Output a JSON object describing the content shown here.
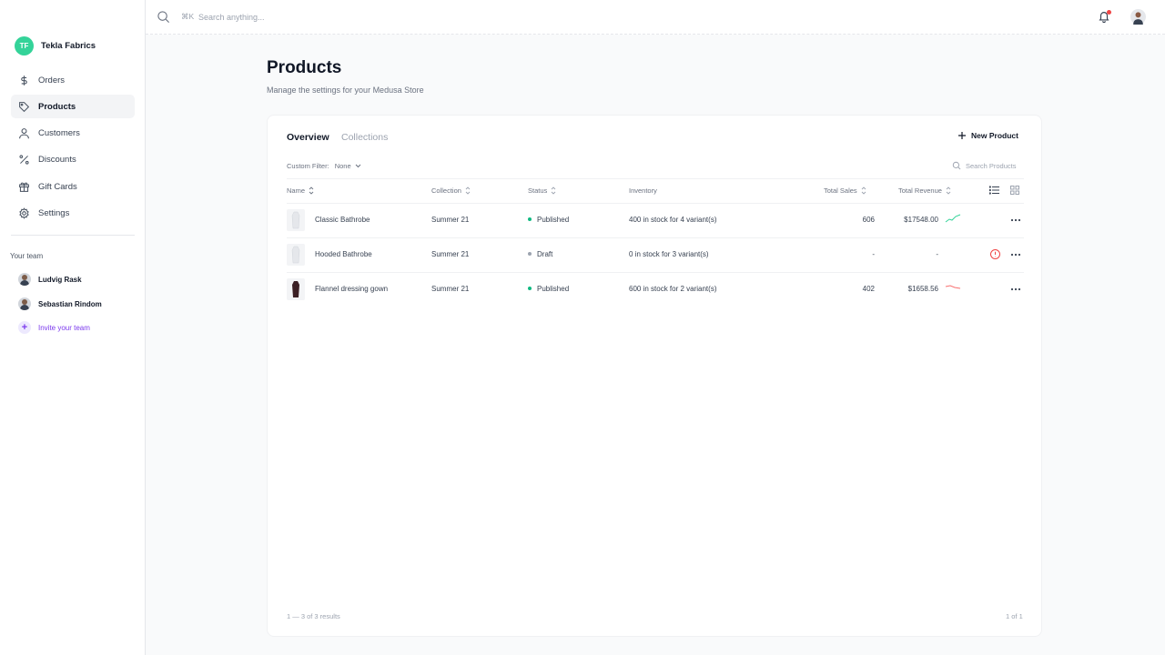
{
  "store": {
    "initials": "TF",
    "name": "Tekla Fabrics"
  },
  "nav": {
    "items": [
      {
        "label": "Orders",
        "icon": "dollar-icon"
      },
      {
        "label": "Products",
        "icon": "tag-icon"
      },
      {
        "label": "Customers",
        "icon": "user-icon"
      },
      {
        "label": "Discounts",
        "icon": "percent-icon"
      },
      {
        "label": "Gift Cards",
        "icon": "gift-icon"
      },
      {
        "label": "Settings",
        "icon": "gear-icon"
      }
    ],
    "active": "Products"
  },
  "team": {
    "title": "Your team",
    "members": [
      "Ludvig Rask",
      "Sebastian Rindom"
    ],
    "invite_label": "Invite your team"
  },
  "topbar": {
    "shortcut": "⌘K",
    "search_placeholder": "Search anything..."
  },
  "page": {
    "title": "Products",
    "subtitle": "Manage the settings for your Medusa Store"
  },
  "tabs": {
    "overview": "Overview",
    "collections": "Collections"
  },
  "actions": {
    "new_product": "New Product"
  },
  "filter": {
    "label": "Custom Filter:",
    "value": "None"
  },
  "search_products": {
    "placeholder": "Search Products"
  },
  "table": {
    "columns": {
      "name": "Name",
      "collection": "Collection",
      "status": "Status",
      "inventory": "Inventory",
      "total_sales": "Total Sales",
      "total_revenue": "Total Revenue"
    },
    "rows": [
      {
        "name": "Classic Bathrobe",
        "collection": "Summer 21",
        "status": "Published",
        "inventory": "400 in stock for 4 variant(s)",
        "total_sales": "606",
        "total_revenue": "$17548.00",
        "trend": "up"
      },
      {
        "name": "Hooded Bathrobe",
        "collection": "Summer 21",
        "status": "Draft",
        "inventory": "0 in stock for 3 variant(s)",
        "total_sales": "-",
        "total_revenue": "-",
        "trend": "none"
      },
      {
        "name": "Flannel dressing gown",
        "collection": "Summer 21",
        "status": "Published",
        "inventory": "600 in stock for 2 variant(s)",
        "total_sales": "402",
        "total_revenue": "$1658.56",
        "trend": "down"
      }
    ]
  },
  "pagination": {
    "results": "1 — 3 of 3 results",
    "pages": "1 of 1"
  },
  "colors": {
    "accent": "#7c3aed",
    "store_avatar": "#34d399",
    "published": "#10b981",
    "draft": "#9ca3af",
    "trend_up": "#34d399",
    "trend_down": "#f87171",
    "alert": "#ef4444"
  }
}
